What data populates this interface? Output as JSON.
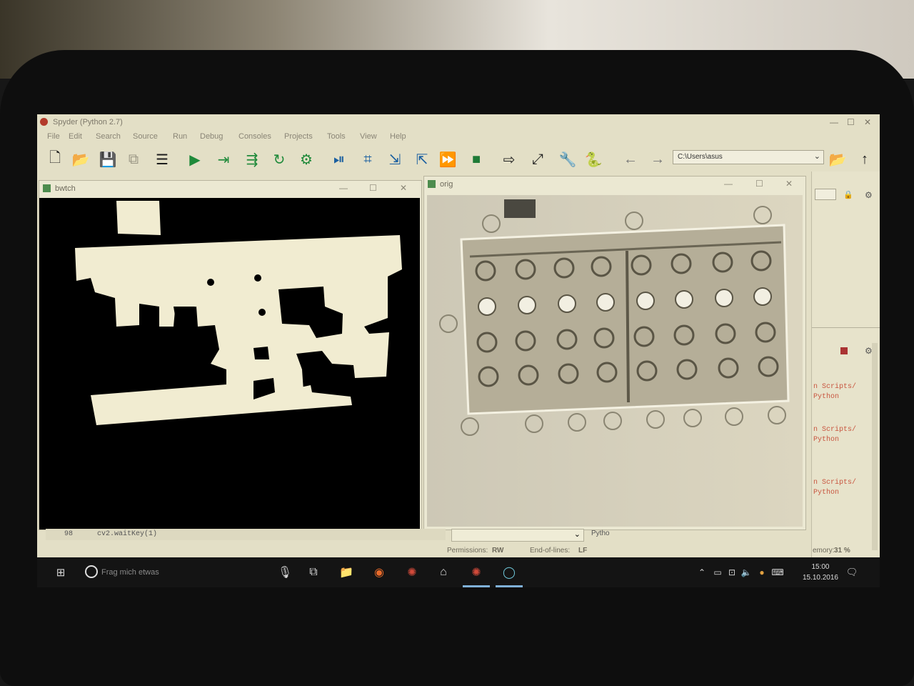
{
  "window": {
    "title": "Spyder (Python 2.7)"
  },
  "menu": [
    "File",
    "Edit",
    "Search",
    "Source",
    "Run",
    "Debug",
    "Consoles",
    "Projects",
    "Tools",
    "View",
    "Help"
  ],
  "toolbar": {
    "path": "C:\\Users\\asus"
  },
  "binary_window": {
    "title": "bwtch"
  },
  "orig_window": {
    "title": "orig"
  },
  "editor": {
    "line_number": "98",
    "code": "cv2.waitKey(1)",
    "interpreter_label": "Pytho"
  },
  "right_panel": {
    "entries": [
      {
        "line1": "n Scripts/",
        "line2": "Python"
      },
      {
        "line1": "n Scripts/",
        "line2": "Python"
      },
      {
        "line1": "n Scripts/",
        "line2": "Python"
      }
    ]
  },
  "status": {
    "permissions_label": "Permissions:",
    "permissions_value": "RW",
    "eol_label": "End-of-lines:",
    "eol_value": "LF",
    "memory_label": "emory:",
    "memory_value": "31 %"
  },
  "taskbar": {
    "search_placeholder": "Frag mich etwas",
    "time": "15:00",
    "date": "15.10.2016"
  },
  "colors": {
    "screen_bg": "#e3dfc6",
    "taskbar": "#141414",
    "run_green": "#1f8a3a"
  }
}
